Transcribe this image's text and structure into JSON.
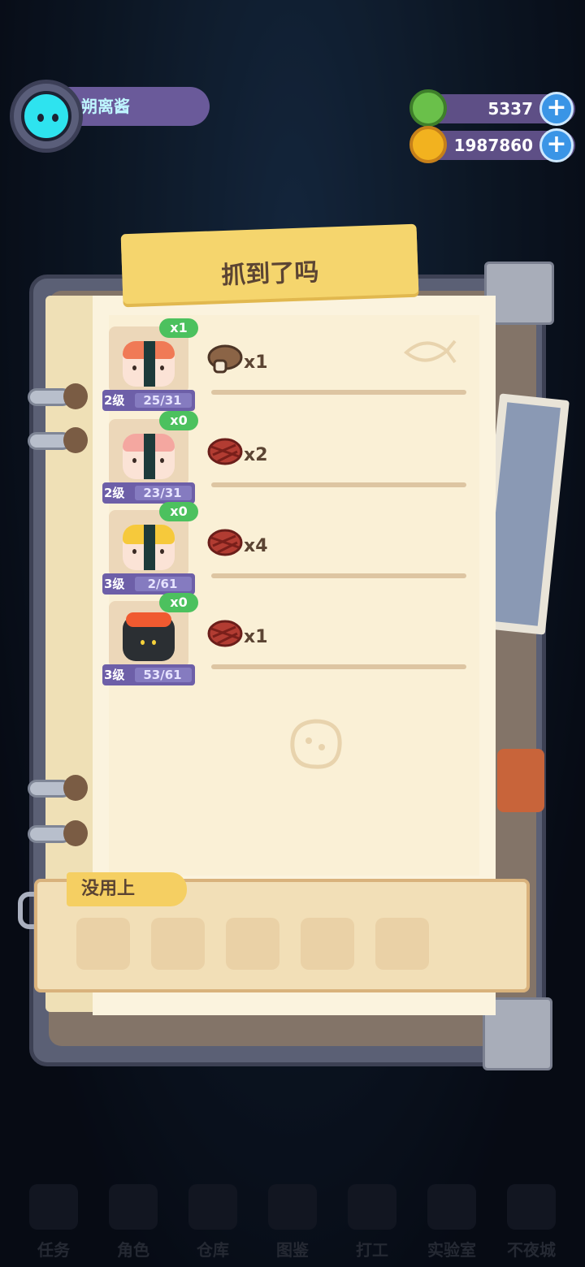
{
  "player": {
    "name": "朔离酱"
  },
  "currencies": [
    {
      "name": "green-gem",
      "value": "5337",
      "color": "#6ac04a"
    },
    {
      "name": "gold-coin",
      "value": "1987860",
      "color": "#f2b21f"
    }
  ],
  "panel": {
    "title": "抓到了吗",
    "rows": [
      {
        "badge": "x1",
        "level": "2级",
        "progress": "25/31",
        "sushi": "salmon-nigiri",
        "ingredient_count": "x1"
      },
      {
        "badge": "x0",
        "level": "2级",
        "progress": "23/31",
        "sushi": "shrimp-nigiri",
        "ingredient_count": "x2"
      },
      {
        "badge": "x0",
        "level": "3级",
        "progress": "2/61",
        "sushi": "tamago-nigiri",
        "ingredient_count": "x4"
      },
      {
        "badge": "x0",
        "level": "3级",
        "progress": "53/61",
        "sushi": "ikura-gunkan",
        "ingredient_count": "x1"
      }
    ],
    "unused_label": "没用上"
  },
  "nav": [
    "任务",
    "角色",
    "仓库",
    "图鉴",
    "打工",
    "实验室",
    "不夜城"
  ],
  "colors": {
    "accent": "#f5d56d",
    "badge": "#4cc15e",
    "level": "#6d5fa8"
  }
}
